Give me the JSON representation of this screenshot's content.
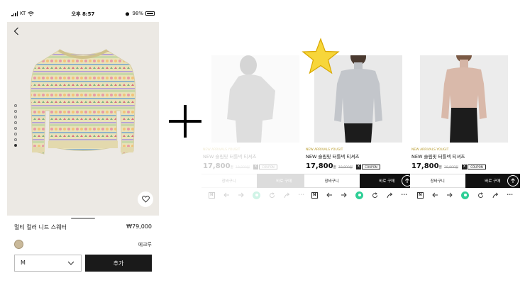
{
  "status_bar": {
    "carrier": "KT",
    "time": "오후 8:57",
    "battery": "98%"
  },
  "product": {
    "name": "멀티 컬러 니트 스웨터",
    "price": "₩79,000",
    "color_name": "에크루",
    "size_value": "M",
    "add_label": "추가",
    "image_count": 8,
    "active_image_index": 7
  },
  "panels": [
    {
      "tag": "NEW ARRIVALS YOUGIT",
      "title": "NEW 슬림핏 터틀넥 티셔츠",
      "price": "17,800",
      "won": "원",
      "old_price": "19,800원",
      "badge": "X",
      "coupon": "COUPON",
      "cart_label": "장바구니",
      "buy_label": "바로 구매"
    },
    {
      "tag": "NEW ARRIVALS YOUGIT",
      "title": "NEW 슬림핏 터틀넥 티셔츠",
      "price": "17,800",
      "won": "원",
      "old_price": "19,800원",
      "badge": "X",
      "coupon": "COUPON",
      "cart_label": "장바구니",
      "buy_label": "바로 구매"
    },
    {
      "tag": "NEW ARRIVALS YOUGIT",
      "title": "NEW 슬림핏 터틀넥 티셔츠",
      "price": "17,800",
      "won": "원",
      "old_price": "19,800원",
      "badge": "X",
      "coupon": "COUPON",
      "cart_label": "장바구니",
      "buy_label": "바로 구매"
    }
  ],
  "browser_nav": {
    "logo_letter": "N",
    "more_label": "•••"
  },
  "colors": {
    "star": "#f7d63a",
    "accent_green": "#2ecf96",
    "tag_gold": "#b79a2a",
    "button_dark": "#1a1a1a"
  },
  "icons": [
    "back-arrow-icon",
    "heart-icon",
    "chevron-down-icon",
    "arrow-up-icon",
    "naver-icon",
    "arrow-left-icon",
    "arrow-right-icon",
    "home-icon",
    "refresh-icon",
    "share-icon",
    "more-icon",
    "star-icon",
    "plus-icon"
  ]
}
